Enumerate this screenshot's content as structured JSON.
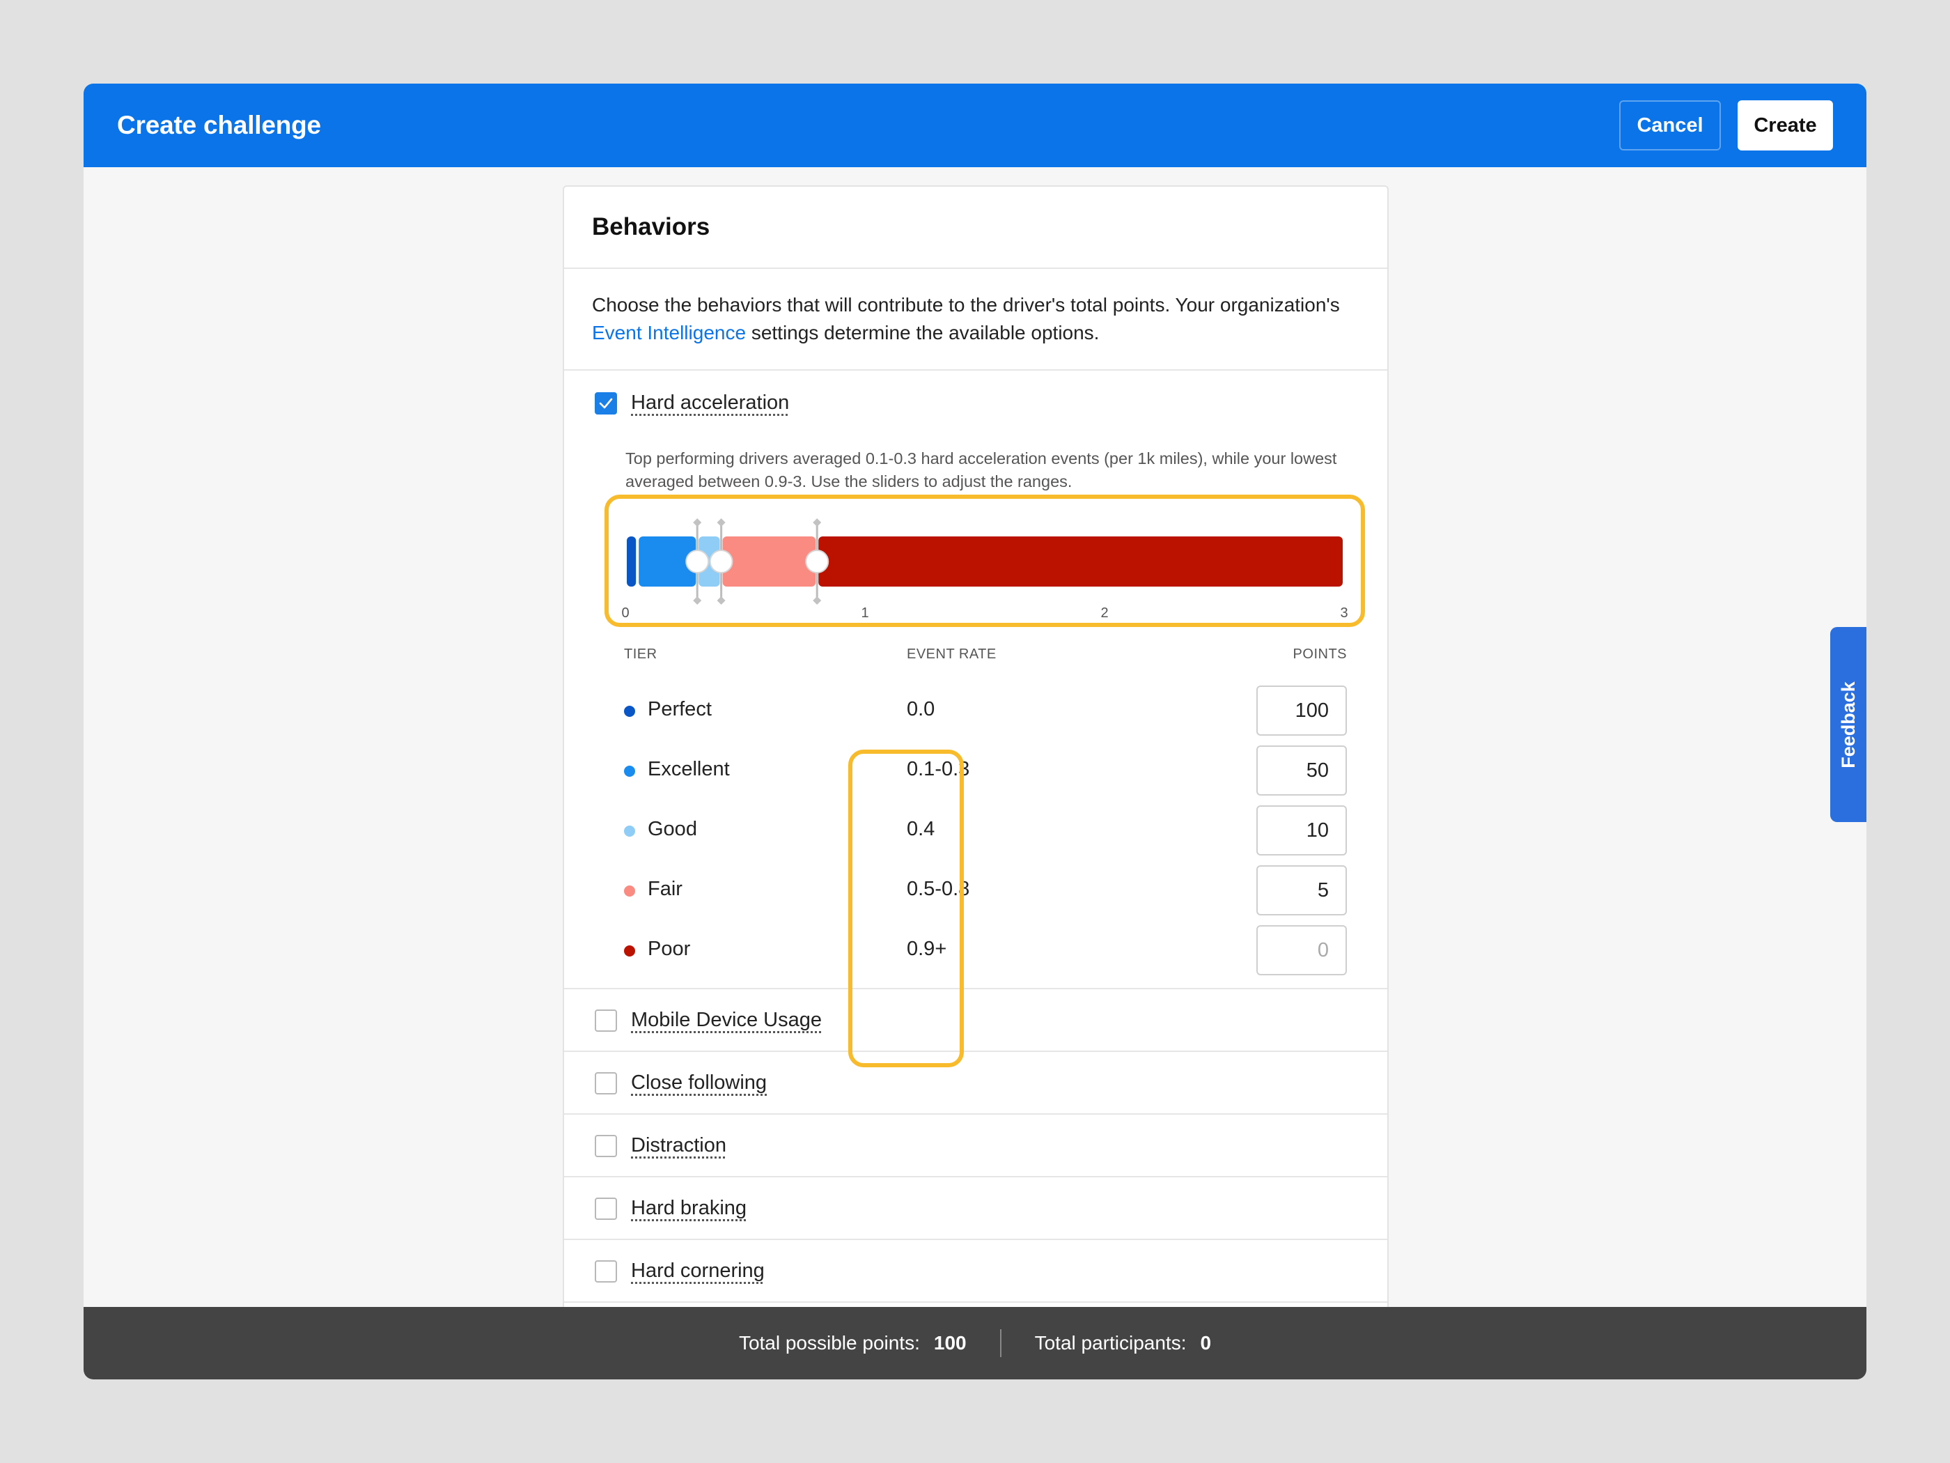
{
  "header": {
    "title": "Create challenge",
    "cancel_label": "Cancel",
    "create_label": "Create"
  },
  "card": {
    "title": "Behaviors",
    "intro_before": "Choose the behaviors that will contribute to the driver's total points. Your organization's ",
    "intro_link": "Event Intelligence",
    "intro_after": " settings determine the available options."
  },
  "active_behavior": {
    "label": "Hard acceleration",
    "checked": true,
    "help_text": "Top performing drivers averaged 0.1-0.3 hard acceleration events (per 1k miles), while your lowest averaged between 0.9-3. Use the sliders to adjust the ranges.",
    "slider": {
      "min": 0,
      "max": 3,
      "tick_labels": [
        "0",
        "1",
        "2",
        "3"
      ],
      "handles": [
        0.3,
        0.4,
        0.8
      ],
      "segments": [
        {
          "tier": "Perfect",
          "from": 0.0,
          "to": 0.05,
          "color": "#0b56c6"
        },
        {
          "tier": "Excellent",
          "from": 0.05,
          "to": 0.3,
          "color": "#1a8cf0"
        },
        {
          "tier": "Good",
          "from": 0.3,
          "to": 0.4,
          "color": "#8fcdf6"
        },
        {
          "tier": "Fair",
          "from": 0.4,
          "to": 0.8,
          "color": "#f98b82"
        },
        {
          "tier": "Poor",
          "from": 0.8,
          "to": 3.0,
          "color": "#bb1200"
        }
      ]
    },
    "columns": {
      "tier": "TIER",
      "rate": "EVENT RATE",
      "points": "POINTS"
    },
    "tiers": [
      {
        "name": "Perfect",
        "rate": "0.0",
        "points": "100",
        "color": "#0b56c6"
      },
      {
        "name": "Excellent",
        "rate": "0.1-0.3",
        "points": "50",
        "color": "#1a8cf0"
      },
      {
        "name": "Good",
        "rate": "0.4",
        "points": "10",
        "color": "#8fcdf6"
      },
      {
        "name": "Fair",
        "rate": "0.5-0.8",
        "points": "5",
        "color": "#f98b82"
      },
      {
        "name": "Poor",
        "rate": "0.9+",
        "points": "0",
        "color": "#bb1200"
      }
    ]
  },
  "other_behaviors": [
    {
      "label": "Mobile Device Usage",
      "checked": false
    },
    {
      "label": "Close following",
      "checked": false
    },
    {
      "label": "Distraction",
      "checked": false
    },
    {
      "label": "Hard braking",
      "checked": false
    },
    {
      "label": "Hard cornering",
      "checked": false
    }
  ],
  "footer": {
    "points_label": "Total possible points:",
    "points_value": "100",
    "participants_label": "Total participants:",
    "participants_value": "0"
  },
  "feedback_label": "Feedback",
  "colors": {
    "brand": "#0a74e8",
    "highlight": "#f7bb2c",
    "footer": "#444444"
  }
}
